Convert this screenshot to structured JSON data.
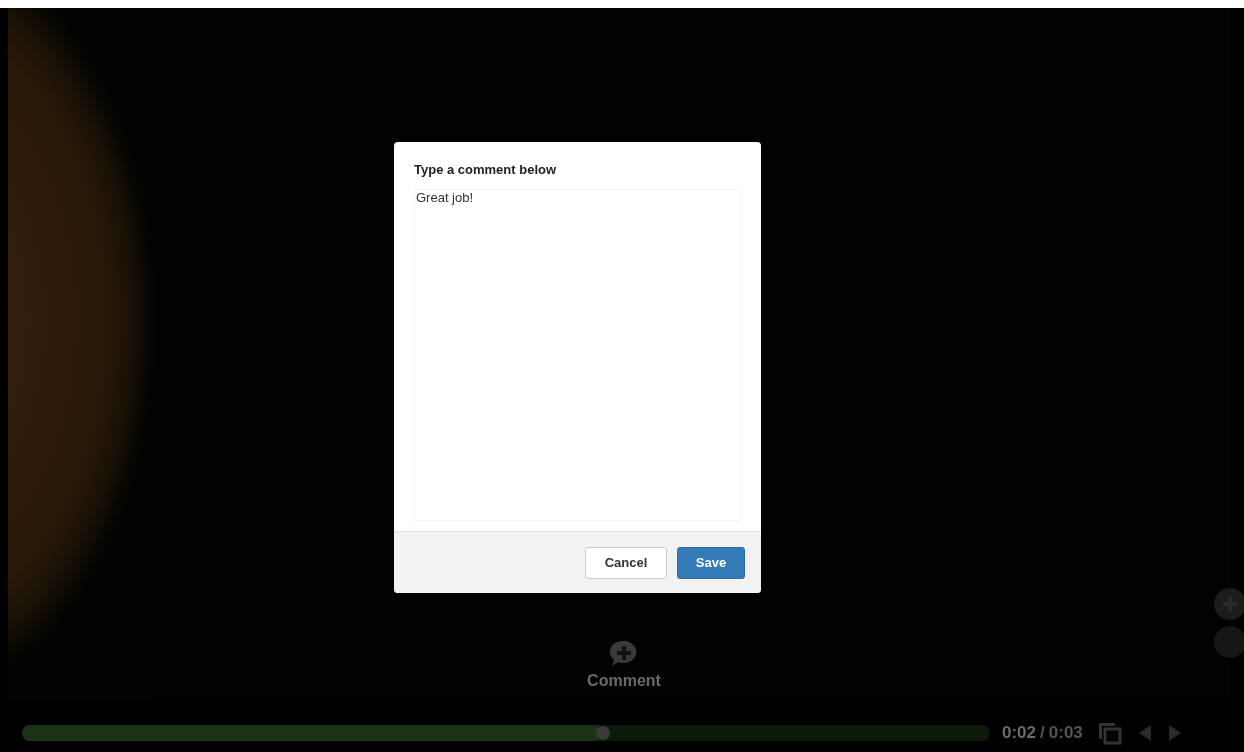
{
  "dialog": {
    "title": "Type a comment below",
    "comment": {
      "value": "Great job!"
    },
    "buttons": [
      {
        "label": "Cancel",
        "kind": "secondary"
      },
      {
        "label": "Save",
        "kind": "primary"
      }
    ]
  },
  "comment_button": {
    "label": "Comment"
  },
  "player": {
    "progress": {
      "level": 0.6
    },
    "current_time": "0:02",
    "separator": "/",
    "duration": "0:03"
  }
}
